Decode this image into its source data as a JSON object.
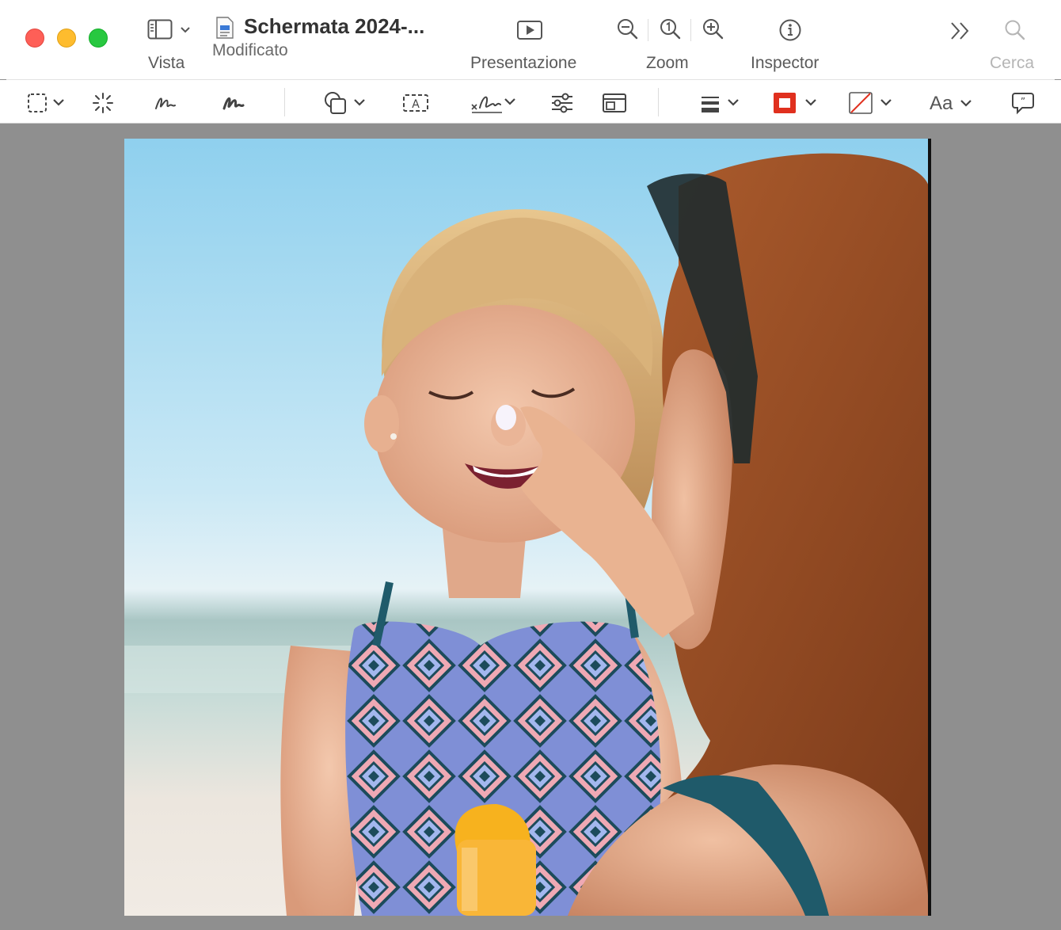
{
  "window": {
    "title": "Schermata 2024-...",
    "subtitle": "Modificato"
  },
  "toolbar": {
    "vista_label": "Vista",
    "presentazione_label": "Presentazione",
    "zoom_label": "Zoom",
    "inspector_label": "Inspector",
    "cerca_label": "Cerca"
  },
  "markup": {
    "font_label": "Aa"
  },
  "colors": {
    "accent_red": "#e0301e",
    "canvas_bg": "#8f8f8f"
  },
  "icons": [
    "sidebar-icon",
    "chevron-down-icon",
    "document-icon",
    "play-icon",
    "zoom-out-icon",
    "actual-size-icon",
    "zoom-in-icon",
    "info-icon",
    "more-icon",
    "search-icon",
    "selection-icon",
    "instant-alpha-icon",
    "sketch-icon",
    "draw-icon",
    "shapes-icon",
    "text-box-icon",
    "signature-icon",
    "adjust-color-icon",
    "adjust-size-icon",
    "line-style-icon",
    "border-color-icon",
    "fill-color-icon",
    "text-style-icon",
    "speech-bubble-icon"
  ]
}
